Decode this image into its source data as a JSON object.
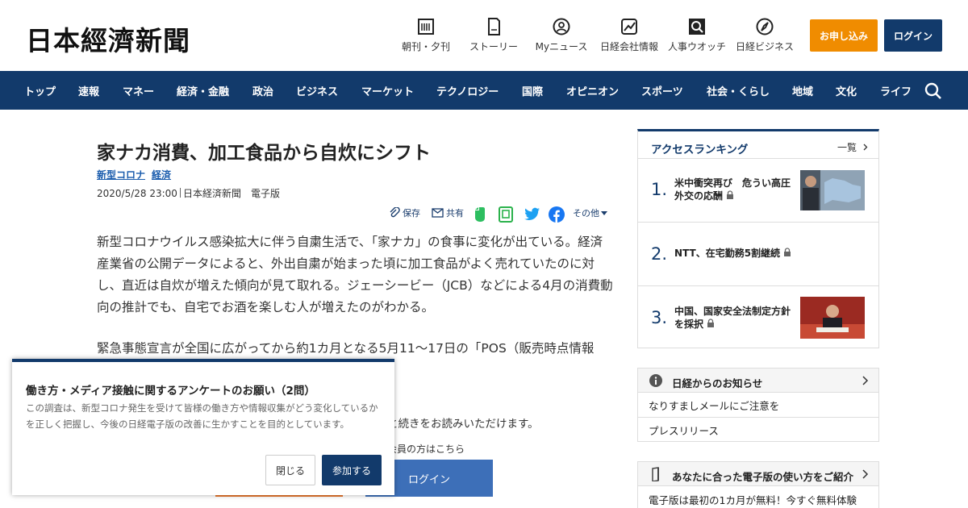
{
  "header": {
    "logo": "日本經濟新聞",
    "nav": [
      {
        "label": "朝刊・夕刊",
        "icon": "newspaper-icon"
      },
      {
        "label": "ストーリー",
        "icon": "story-icon"
      },
      {
        "label": "Myニュース",
        "icon": "user-circle-icon"
      },
      {
        "label": "日経会社情報",
        "icon": "chart-icon"
      },
      {
        "label": "人事ウオッチ",
        "icon": "search-person-icon"
      },
      {
        "label": "日経ビジネス",
        "icon": "compass-icon"
      }
    ],
    "apply_label": "お申し込み",
    "login_label": "ログイン"
  },
  "navbar": {
    "items": [
      "トップ",
      "速報",
      "マネー",
      "経済・金融",
      "政治",
      "ビジネス",
      "マーケット",
      "テクノロジー",
      "国際",
      "オピニオン",
      "スポーツ",
      "社会・くらし",
      "地域",
      "文化",
      "ライフ"
    ],
    "search_icon": "search-icon"
  },
  "article": {
    "title": "家ナカ消費、加工食品から自炊にシフト",
    "tags": [
      "新型コロナ",
      "経済"
    ],
    "date": "2020/5/28 23:00",
    "source": "日本経済新聞　電子版",
    "share": {
      "save": "保存",
      "share": "共有",
      "other": "その他"
    },
    "paragraph1": "新型コロナウイルス感染拡大に伴う自粛生活で、「家ナカ」の食事に変化が出ている。経済産業省の公開データによると、外出自粛が始まった頃に加工食品がよく売れていたのに対し、直近は自炊が増えた傾向が見て取れる。ジェーシービー（JCB）などによる4月の消費動向の推計でも、自宅でお酒を楽しむ人が増えたのがわかる。",
    "paragraph2": "緊急事態宣言が全国に広がってから約1カ月となる5月11～17日の「POS（販売時点情報",
    "continue_text": "と続きをお読みいただけます。",
    "member_text": "会員の方はこちら",
    "login_label": "ログイン"
  },
  "survey": {
    "title": "働き方・メディア接触に関するアンケートのお願い（2問）",
    "desc": "この調査は、新型コロナ発生を受けて皆様の働き方や情報収集がどう変化しているかを正しく把握し、今後の日経電子版の改善に生かすことを目的としています。",
    "close_label": "閉じる",
    "join_label": "参加する"
  },
  "ranking": {
    "title": "アクセスランキング",
    "more": "一覧",
    "items": [
      {
        "num": "1.",
        "title": "米中衝突再び　危うい高圧外交の応酬",
        "has_thumb": true
      },
      {
        "num": "2.",
        "title": "NTT、在宅勤務5割継続",
        "has_thumb": false
      },
      {
        "num": "3.",
        "title": "中国、国家安全法制定方針を採択",
        "has_thumb": true
      }
    ]
  },
  "notice": {
    "title": "日経からのお知らせ",
    "items": [
      "なりすましメールにご注意を",
      "プレスリリース"
    ]
  },
  "guide": {
    "title": "あなたに合った電子版の使い方をご紹介",
    "line": "電子版は最初の1カ月が無料！今すぐ無料体験"
  },
  "colors": {
    "navy": "#123a6b",
    "orange": "#f08c00",
    "link": "#1a5cad"
  }
}
